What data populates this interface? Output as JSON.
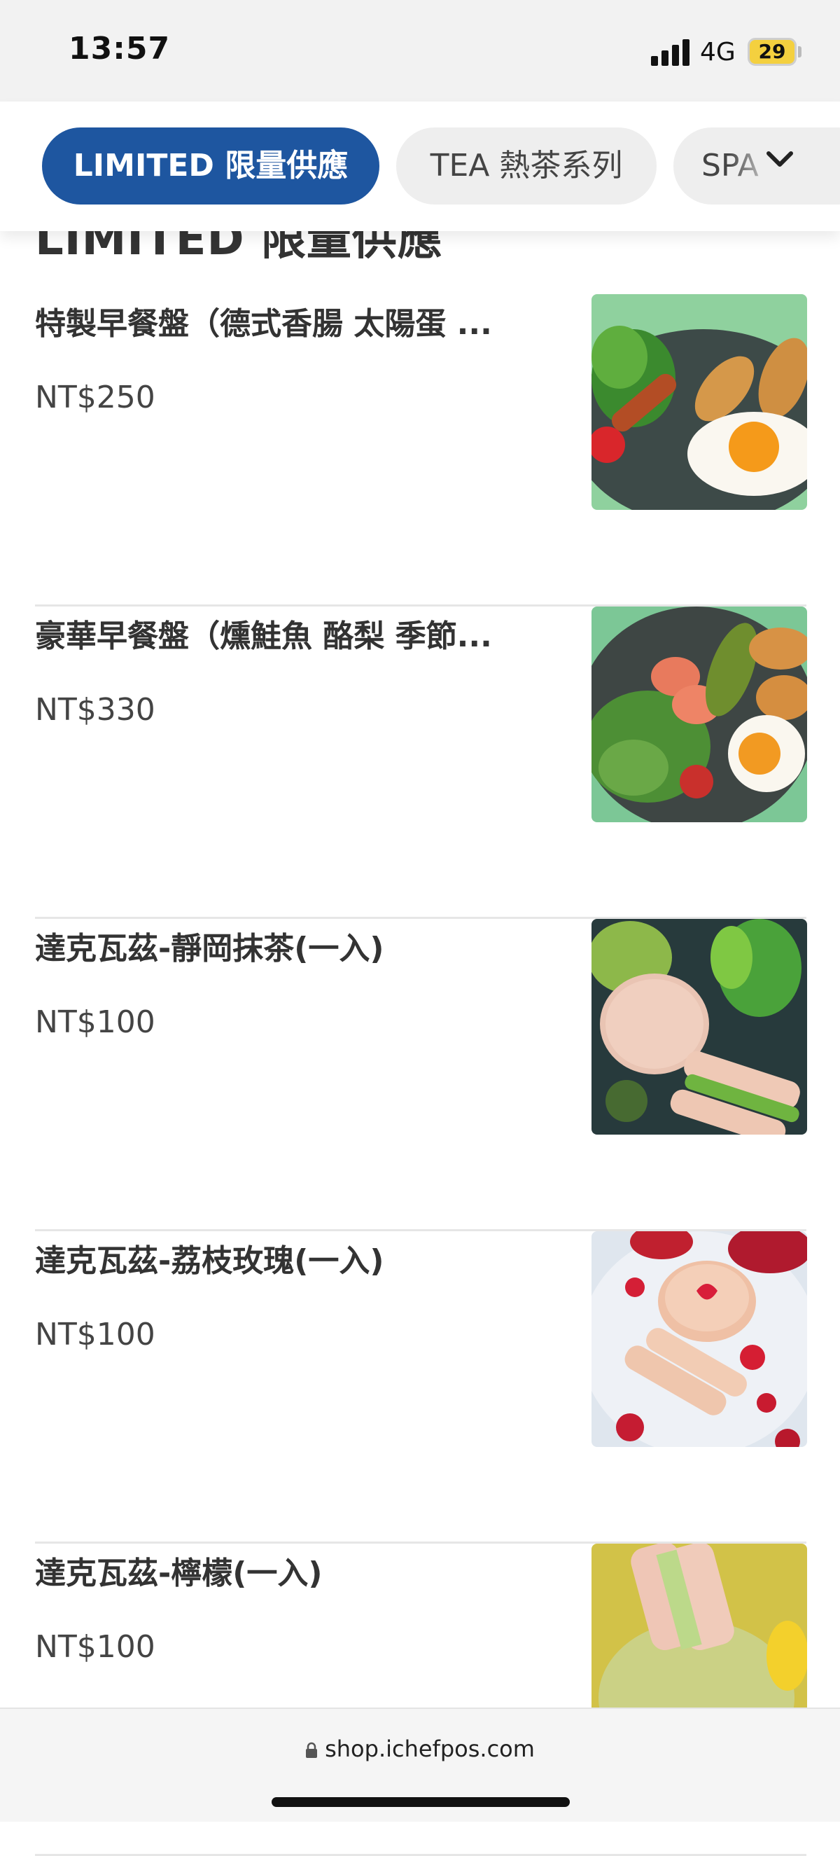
{
  "status_bar": {
    "time": "13:57",
    "network": "4G",
    "battery": "29"
  },
  "tabs": [
    {
      "label": "LIMITED 限量供應",
      "active": true
    },
    {
      "label": "TEA 熱茶系列",
      "active": false
    },
    {
      "label": "SPA",
      "active": false
    }
  ],
  "tabs_dropdown_icon": "chevron-down-icon",
  "section": {
    "title": "LIMITED 限量供應"
  },
  "menu": {
    "items": [
      {
        "name": "特製早餐盤（德式香腸 太陽蛋 ...",
        "price": "NT$250"
      },
      {
        "name": "豪華早餐盤（燻鮭魚 酪梨 季節...",
        "price": "NT$330"
      },
      {
        "name": "達克瓦茲-靜岡抹茶(一入)",
        "price": "NT$100"
      },
      {
        "name": "達克瓦茲-荔枝玫瑰(一入)",
        "price": "NT$100"
      },
      {
        "name": "達克瓦茲-檸檬(一入)",
        "price": "NT$100"
      }
    ]
  },
  "browser": {
    "url": "shop.ichefpos.com"
  },
  "colors": {
    "accent": "#1e56a0",
    "tab_inactive_bg": "#eeeeee",
    "battery": "#f4d03f"
  }
}
